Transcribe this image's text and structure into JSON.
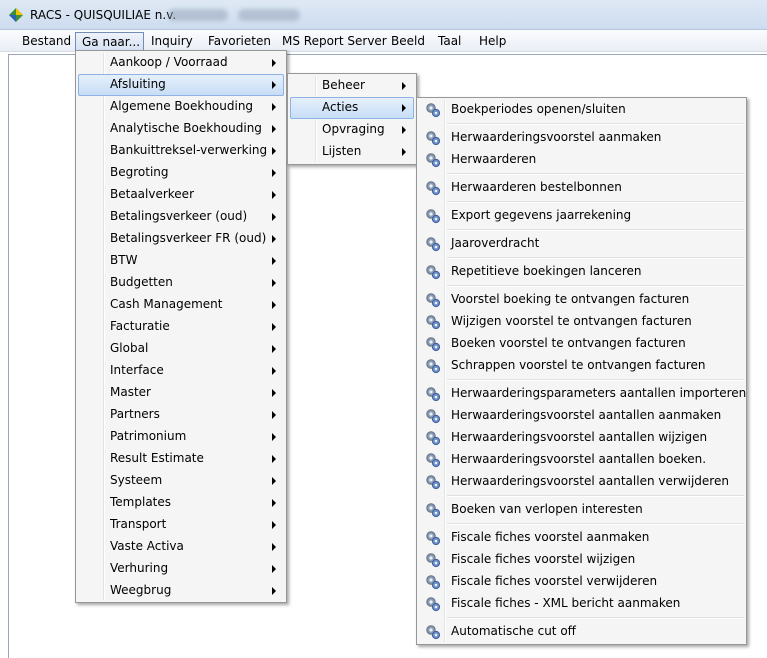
{
  "window": {
    "title": "RACS - QUISQUILIAE n.v."
  },
  "menubar": {
    "items": [
      "Bestand",
      "Ga naar...",
      "Inquiry",
      "Favorieten",
      "MS Report Server",
      "Beeld",
      "Taal",
      "Help"
    ],
    "active": "Ga naar..."
  },
  "menu_ganaar": {
    "items": [
      "Aankoop / Voorraad",
      "Afsluiting",
      "Algemene Boekhouding",
      "Analytische Boekhouding",
      "Bankuittreksel-verwerking",
      "Begroting",
      "Betaalverkeer",
      "Betalingsverkeer (oud)",
      "Betalingsverkeer FR (oud)",
      "BTW",
      "Budgetten",
      "Cash Management",
      "Facturatie",
      "Global",
      "Interface",
      "Master",
      "Partners",
      "Patrimonium",
      "Result Estimate",
      "Systeem",
      "Templates",
      "Transport",
      "Vaste Activa",
      "Verhuring",
      "Weegbrug"
    ],
    "highlighted": "Afsluiting"
  },
  "menu_afsluiting": {
    "items": [
      "Beheer",
      "Acties",
      "Opvraging",
      "Lijsten"
    ],
    "highlighted": "Acties"
  },
  "menu_acties": {
    "groups": [
      [
        "Boekperiodes openen/sluiten"
      ],
      [
        "Herwaarderingsvoorstel aanmaken",
        "Herwaarderen"
      ],
      [
        "Herwaarderen bestelbonnen"
      ],
      [
        "Export gegevens jaarrekening"
      ],
      [
        "Jaaroverdracht"
      ],
      [
        "Repetitieve boekingen lanceren"
      ],
      [
        "Voorstel boeking te ontvangen facturen",
        "Wijzigen voorstel te ontvangen facturen",
        "Boeken voorstel te ontvangen facturen",
        "Schrappen voorstel te ontvangen facturen"
      ],
      [
        "Herwaarderingsparameters aantallen importeren",
        "Herwaarderingsvoorstel aantallen aanmaken",
        "Herwaarderingsvoorstel aantallen wijzigen",
        "Herwaarderingsvoorstel aantallen boeken.",
        "Herwaarderingsvoorstel aantallen verwijderen"
      ],
      [
        "Boeken van verlopen interesten"
      ],
      [
        "Fiscale fiches voorstel aanmaken",
        "Fiscale fiches voorstel wijzigen",
        "Fiscale fiches voorstel verwijderen",
        "Fiscale fiches - XML bericht aanmaken"
      ],
      [
        "Automatische cut off"
      ]
    ],
    "item_icon": "gear-icon"
  },
  "colors": {
    "highlight_bg": "#cfe2f8",
    "highlight_border": "#8db2e3",
    "menu_bg": "#f5f5f5",
    "titlebar": "#d3e1f2"
  }
}
